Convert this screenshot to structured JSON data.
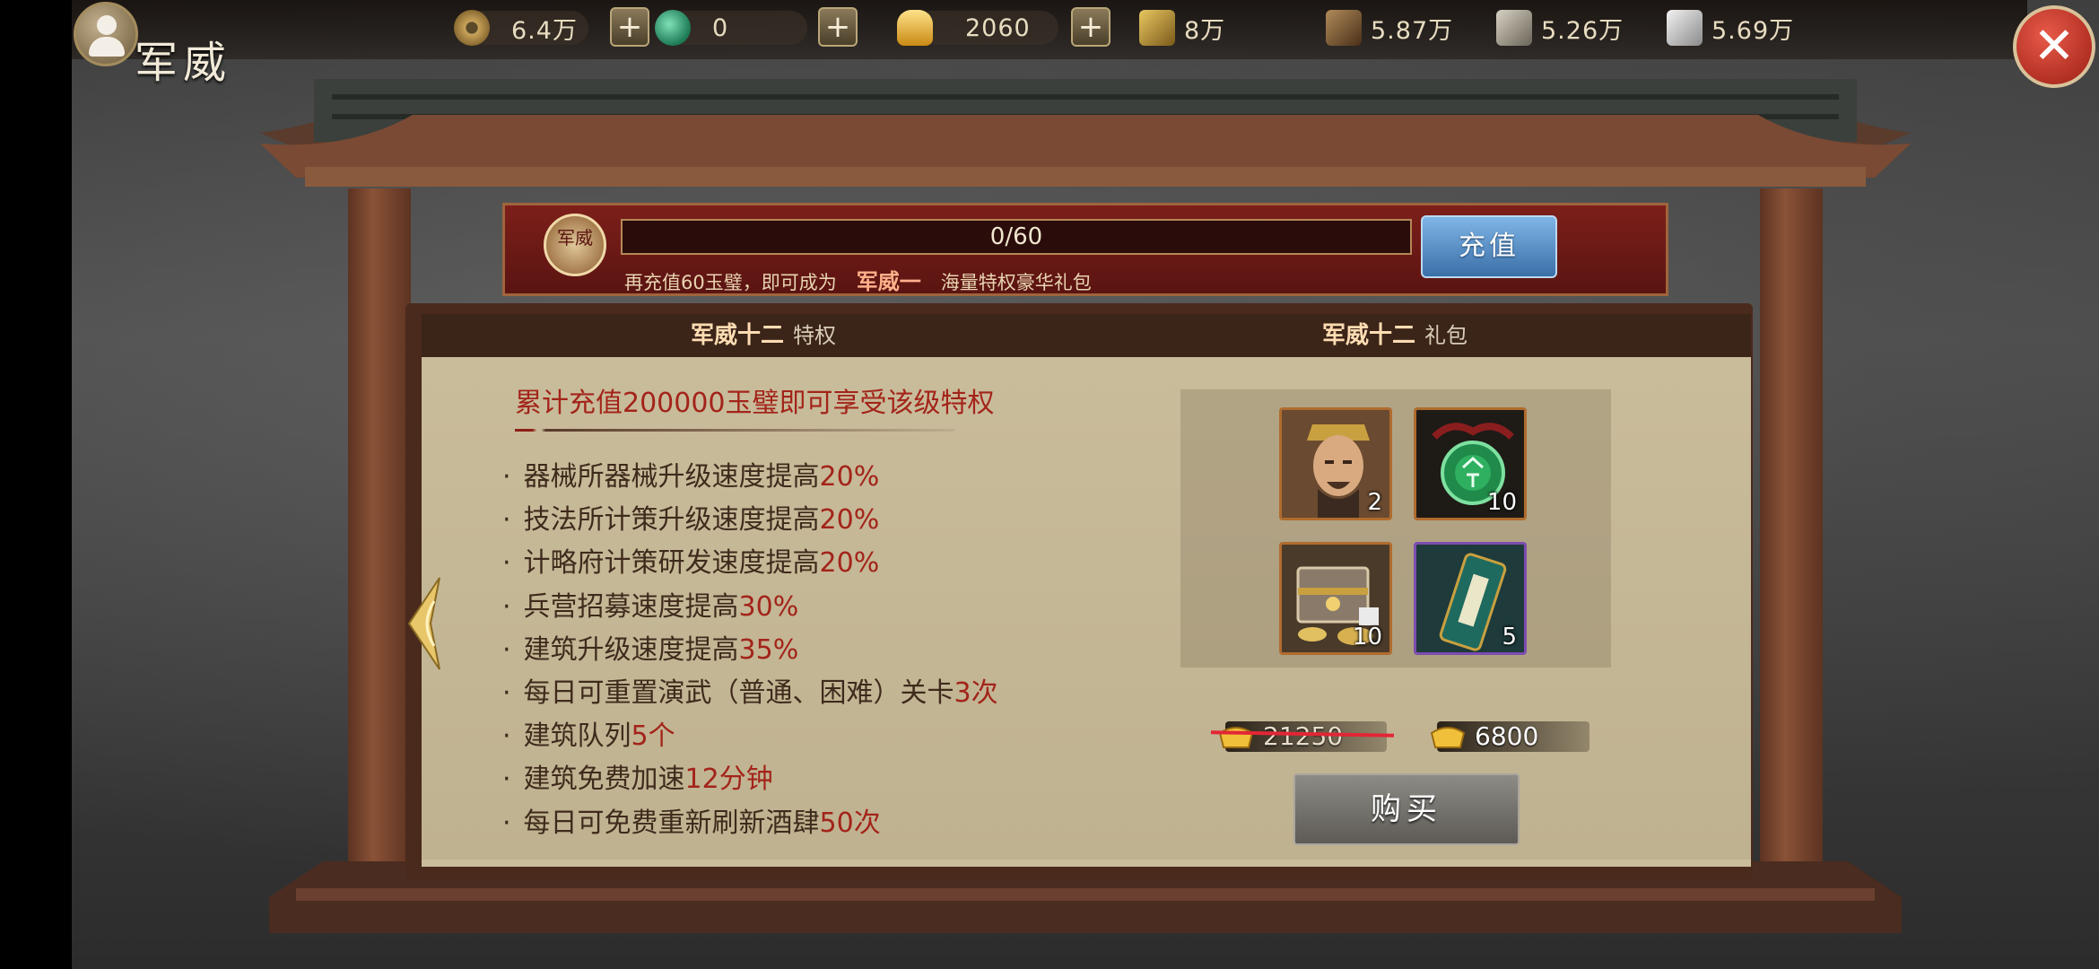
{
  "header": {
    "title": "军威",
    "resources": [
      {
        "name": "copper-coin",
        "value": "6.4万"
      },
      {
        "name": "jade",
        "value": "0"
      },
      {
        "name": "gold-ingot",
        "value": "2060"
      },
      {
        "name": "grain",
        "value": "8万"
      },
      {
        "name": "wood",
        "value": "5.87万"
      },
      {
        "name": "stone",
        "value": "5.26万"
      },
      {
        "name": "iron",
        "value": "5.69万"
      }
    ],
    "plus_label": "+",
    "close_label": "✕"
  },
  "recharge": {
    "emblem_text": "军威",
    "progress_current": 0,
    "progress_max": 60,
    "progress_text": "0/60",
    "note_prefix": "再充值60玉璧，即可成为",
    "rank_name": "军威一",
    "note_suffix": "海量特权豪华礼包",
    "button_label": "充值"
  },
  "privilege_section": {
    "rank": "军威十二",
    "label": "特权",
    "requirement": "累计充值200000玉璧即可享受该级特权",
    "items": [
      {
        "text": "器械所器械升级速度提高",
        "value": "20%"
      },
      {
        "text": "技法所计策升级速度提高",
        "value": "20%"
      },
      {
        "text": "计略府计策研发速度提高",
        "value": "20%"
      },
      {
        "text": "兵营招募速度提高",
        "value": "30%"
      },
      {
        "text": "建筑升级速度提高",
        "value": "35%"
      },
      {
        "text": "每日可重置演武（普通、困难）关卡",
        "value": "3次"
      },
      {
        "text": "建筑队列",
        "value": "5个"
      },
      {
        "text": "建筑免费加速",
        "value": "12分钟"
      },
      {
        "text": "每日可免费重新刷新酒肆",
        "value": "50次"
      }
    ]
  },
  "gift_section": {
    "rank": "军威十二",
    "label": "礼包",
    "items": [
      {
        "name": "general-portrait",
        "count": "2"
      },
      {
        "name": "jade-token",
        "count": "10"
      },
      {
        "name": "treasure-chest",
        "count": "10"
      },
      {
        "name": "teal-scroll",
        "count": "5"
      }
    ],
    "original_price": "21250",
    "price": "6800",
    "buy_label": "购买"
  },
  "colors": {
    "accent_red": "#a3241a",
    "banner_red": "#7d1f1a",
    "recharge_blue": "#3a6fa8",
    "parchment": "#cbbd9c"
  }
}
